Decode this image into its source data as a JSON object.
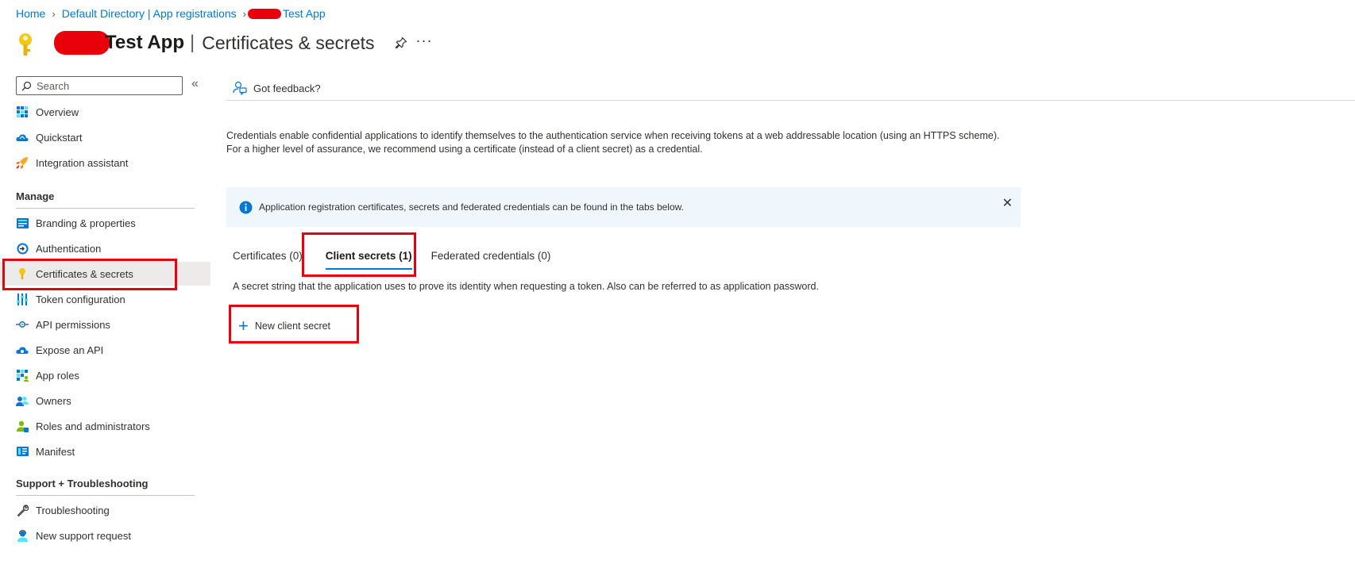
{
  "breadcrumb": {
    "home": "Home",
    "directory": "Default Directory | App registrations",
    "app": "Test App"
  },
  "header": {
    "title": "Test App",
    "separator": "|",
    "subtitle": "Certificates & secrets",
    "pin_icon": "pin-icon",
    "more_label": "···"
  },
  "sidebar": {
    "search_placeholder": "Search",
    "collapse_label": "«",
    "top_items": [
      {
        "label": "Overview",
        "icon": "overview-icon"
      },
      {
        "label": "Quickstart",
        "icon": "quickstart-icon"
      },
      {
        "label": "Integration assistant",
        "icon": "rocket-icon"
      }
    ],
    "manage_header": "Manage",
    "manage_items": [
      {
        "label": "Branding & properties",
        "icon": "branding-icon"
      },
      {
        "label": "Authentication",
        "icon": "authentication-icon"
      },
      {
        "label": "Certificates & secrets",
        "icon": "key-icon",
        "active": true
      },
      {
        "label": "Token configuration",
        "icon": "token-icon"
      },
      {
        "label": "API permissions",
        "icon": "api-permissions-icon"
      },
      {
        "label": "Expose an API",
        "icon": "cloud-icon"
      },
      {
        "label": "App roles",
        "icon": "app-roles-icon"
      },
      {
        "label": "Owners",
        "icon": "owners-icon"
      },
      {
        "label": "Roles and administrators",
        "icon": "roles-icon"
      },
      {
        "label": "Manifest",
        "icon": "manifest-icon"
      }
    ],
    "support_header": "Support + Troubleshooting",
    "support_items": [
      {
        "label": "Troubleshooting",
        "icon": "wrench-icon"
      },
      {
        "label": "New support request",
        "icon": "support-icon"
      }
    ]
  },
  "main": {
    "feedback_label": "Got feedback?",
    "description": "Credentials enable confidential applications to identify themselves to the authentication service when receiving tokens at a web addressable location (using an HTTPS scheme). For a higher level of assurance, we recommend using a certificate (instead of a client secret) as a credential.",
    "info_banner": "Application registration certificates, secrets and federated credentials can be found in the tabs below.",
    "close_label": "✕",
    "tabs": [
      {
        "label": "Certificates (0)",
        "selected": false
      },
      {
        "label": "Client secrets (1)",
        "selected": true
      },
      {
        "label": "Federated credentials (0)",
        "selected": false
      }
    ],
    "secret_description": "A secret string that the application uses to prove its identity when requesting a token. Also can be referred to as application password.",
    "new_secret_label": "New client secret",
    "new_secret_plus": "+"
  },
  "colors": {
    "accent": "#0078d4",
    "highlight": "#e8000b",
    "active_nav_bg": "#edebe9",
    "banner_bg": "#eff6fc"
  }
}
